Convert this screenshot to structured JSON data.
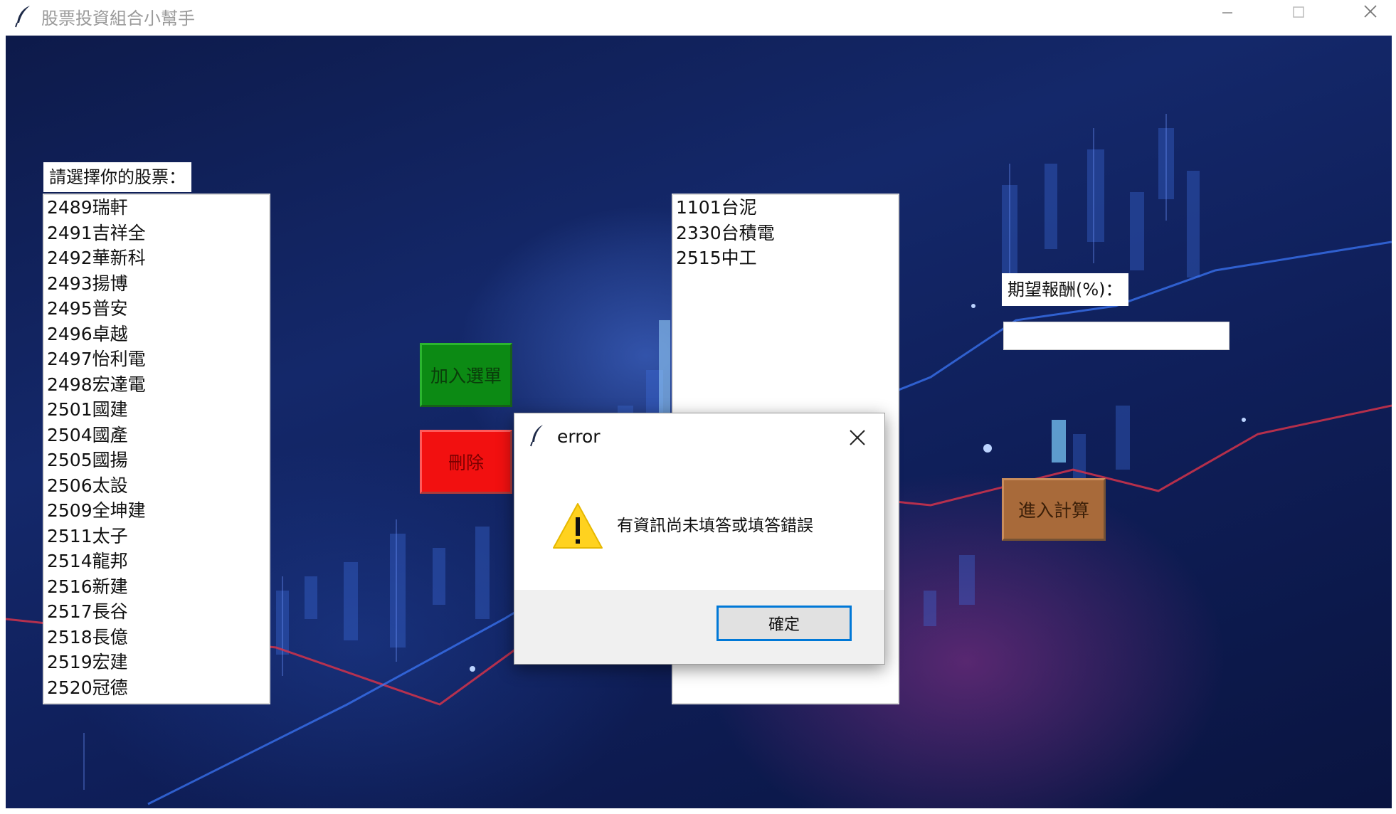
{
  "window": {
    "title": "股票投資組合小幫手",
    "icon": "feather-icon",
    "controls": [
      "minimize-icon",
      "maximize-icon",
      "close-icon"
    ]
  },
  "stock_picker": {
    "label": "請選擇你的股票：",
    "items": [
      "2489瑞軒",
      "2491吉祥全",
      "2492華新科",
      "2493揚博",
      "2495普安",
      "2496卓越",
      "2497怡利電",
      "2498宏達電",
      "2501國建",
      "2504國產",
      "2505國揚",
      "2506太設",
      "2509全坤建",
      "2511太子",
      "2514龍邦",
      "2516新建",
      "2517長谷",
      "2518長億",
      "2519宏建",
      "2520冠德"
    ]
  },
  "buttons": {
    "add": "加入選單",
    "delete": "刪除",
    "calculate": "進入計算"
  },
  "selected": {
    "items": [
      "1101台泥",
      "2330台積電",
      "2515中工"
    ]
  },
  "expected_return": {
    "label": "期望報酬(%)：",
    "value": ""
  },
  "dialog": {
    "title": "error",
    "message": "有資訊尚未填答或填答錯誤",
    "ok": "確定",
    "icon": "warning-icon"
  },
  "colors": {
    "add_button": "#0c8a14",
    "delete_button": "#f21010",
    "calc_button": "#a86a3a",
    "focus_border": "#0078d7"
  }
}
